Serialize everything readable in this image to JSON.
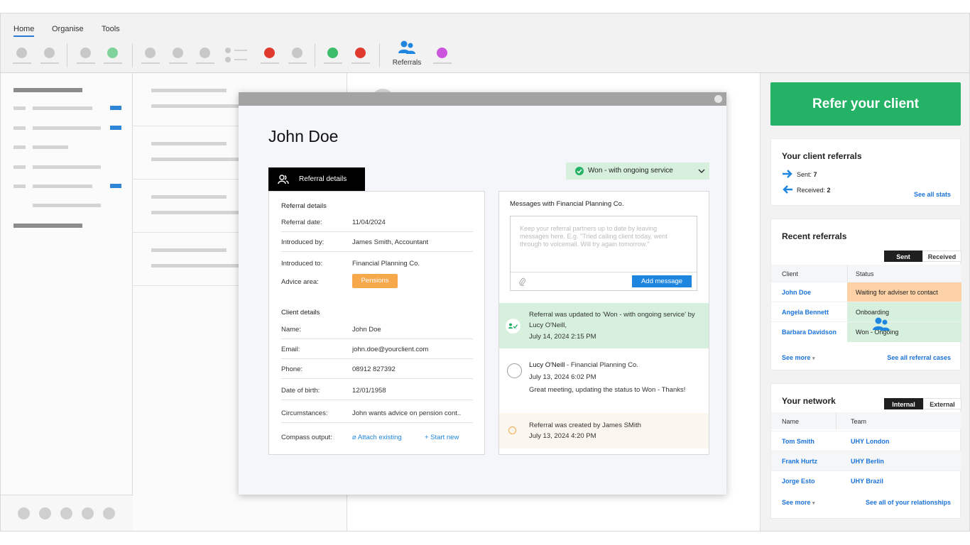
{
  "ribbon": {
    "tabs": [
      {
        "label": "Home",
        "active": true
      },
      {
        "label": "Organise",
        "active": false
      },
      {
        "label": "Tools",
        "active": false
      }
    ],
    "referrals_label": "Referrals",
    "colors": {
      "red": "#e03a2f",
      "green": "#3dbd6a",
      "light_green": "#7fd39a",
      "purple": "#cc55dd",
      "grey": "#c8c8c8"
    }
  },
  "modal": {
    "client_name": "John Doe",
    "tab_label": "Referral details",
    "status": "Won - with ongoing service",
    "referral_section": "Referral details",
    "referral_rows": [
      {
        "key": "Referral date:",
        "value": "11/04/2024"
      },
      {
        "key": "Introduced by:",
        "value": "James Smith, Accountant"
      },
      {
        "key": "Introduced to:",
        "value": "Financial Planning Co."
      },
      {
        "key": "Advice area:",
        "value": "Pensions"
      }
    ],
    "client_section": "Client details",
    "client_rows": [
      {
        "key": "Name:",
        "value": "John Doe"
      },
      {
        "key": "Email:",
        "value": "john.doe@yourclient.com"
      },
      {
        "key": "Phone:",
        "value": "08912 827392"
      },
      {
        "key": "Date of birth:",
        "value": "12/01/1958"
      },
      {
        "key": "Circumstances:",
        "value": "John wants advice on pension cont.."
      }
    ],
    "compass": {
      "key": "Compass output:",
      "attach": "Attach existing",
      "start": "+ Start new"
    },
    "messages": {
      "title": "Messages with Financial Planning Co.",
      "placeholder": "Keep your referral partners up to date by leaving messages here. E.g. \"Tried calling client today, went through to voicemail. Will try again tomorrow.\"",
      "add_button": "Add message",
      "feed": [
        {
          "text": "Referral was updated to 'Won - with ongoing service' by Lucy O'Neill,",
          "time": "July 14, 2024 2:15 PM"
        },
        {
          "author": "Lucy O'Neill",
          "org": " - Financial Planning Co.",
          "time": "July 13, 2024 6:02 PM",
          "text": "Great meeting, updating the status to Won - Thanks!"
        },
        {
          "text": "Referral was created by James SMith",
          "time": "July 13, 2024 4:20 PM"
        }
      ]
    }
  },
  "right": {
    "refer_button": "Refer your client",
    "referrals_card": {
      "title": "Your client referrals",
      "sent_label": "Sent:",
      "sent_value": "7",
      "received_label": "Received:",
      "received_value": "2",
      "see_all_stats": "See all stats"
    },
    "recent": {
      "title": "Recent referrals",
      "toggle_on": "Sent",
      "toggle_off": "Received",
      "col_client": "Client",
      "col_status": "Status",
      "rows": [
        {
          "client": "John Doe",
          "status": "Waiting for adviser to contact"
        },
        {
          "client": "Angela Bennett",
          "status": "Onboarding"
        },
        {
          "client": "Barbara Davidson",
          "status": "Won - Ongoing"
        }
      ],
      "see_more": "See more",
      "see_all": "See all referral cases"
    },
    "network": {
      "title": "Your network",
      "toggle_on": "Internal",
      "toggle_off": "External",
      "col_name": "Name",
      "col_team": "Team",
      "rows": [
        {
          "name": "Tom Smith",
          "team": "UHY London"
        },
        {
          "name": "Frank Hurtz",
          "team": "UHY Berlin"
        },
        {
          "name": "Jorge Esto",
          "team": "UHY Brazil"
        }
      ],
      "see_more": "See more",
      "see_all": "See all of your relationships"
    }
  }
}
